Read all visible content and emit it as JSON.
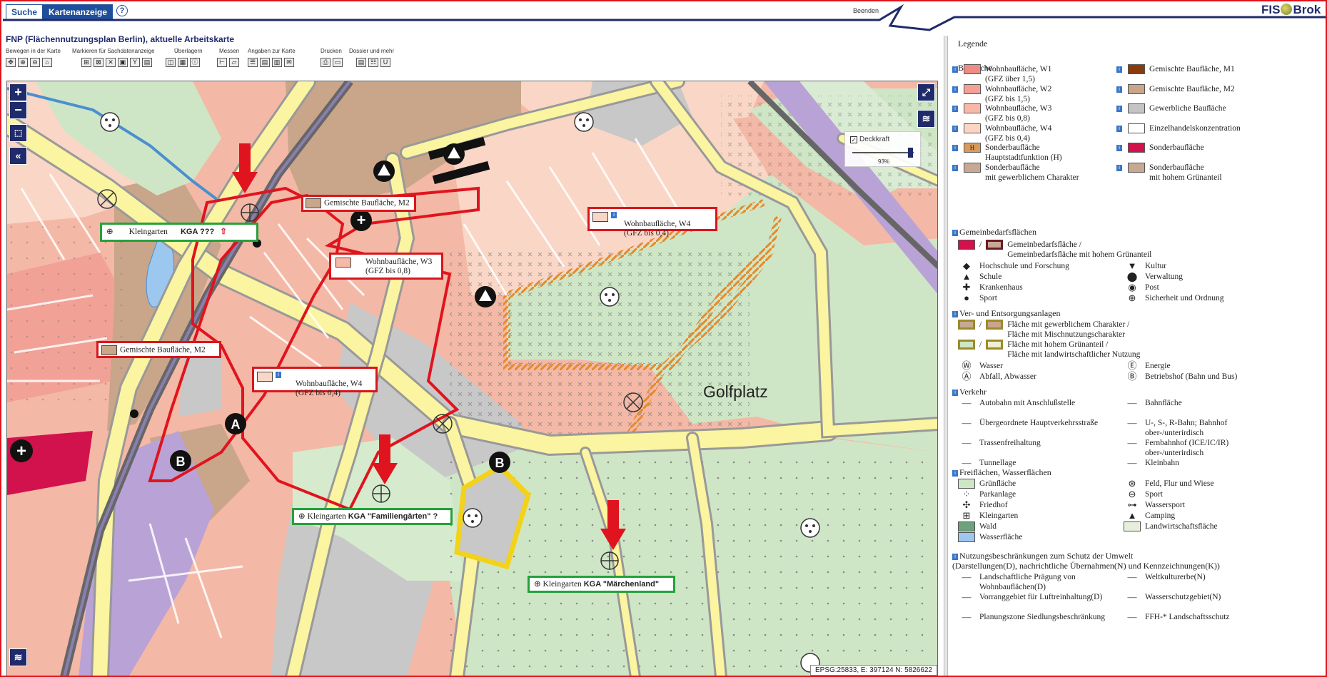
{
  "tabs": [
    {
      "label": "Suche"
    },
    {
      "label": "Kartenanzeige"
    }
  ],
  "help_label": "?",
  "beenden": "Beenden",
  "logo": {
    "text_left": "FIS",
    "text_right": "Brok"
  },
  "page_title": "FNP (Flächennutzungsplan Berlin), aktuelle Arbeitskarte",
  "toolbar": {
    "groups": [
      {
        "label": "Bewegen in der Karte"
      },
      {
        "label": "Markieren für Sachdatenanzeige"
      },
      {
        "label": "Überlagern"
      },
      {
        "label": "Messen"
      },
      {
        "label": "Angaben zur Karte"
      },
      {
        "label": "Drucken"
      },
      {
        "label": "Dossier und mehr"
      }
    ]
  },
  "map": {
    "zoom_in": "+",
    "zoom_out": "−",
    "collapse": "«",
    "opacity": {
      "label": "Deckkraft",
      "value": "93%"
    },
    "epsg": "EPSG:25833, E: 397124 N: 5826622",
    "golf_label": "Golfplatz",
    "callouts": {
      "m2_top": "Gemischte Bauﬂäche, M2",
      "kga1_prefix": "Kleingarten",
      "kga1_name": "KGA ???",
      "w4_top": "Wohnbauﬂäche, W4",
      "w4_top_sub": "(GFZ bis 0,4)",
      "w3": "Wohnbauﬂäche, W3",
      "w3_sub": "(GFZ bis 0,8)",
      "m2_left": "Gemischte Bauﬂäche, M2",
      "w4_mid": "Wohnbauﬂäche, W4",
      "w4_mid_sub": "(GFZ bis 0,4)",
      "kga2_prefix": "Kleingarten",
      "kga2_name": "KGA \"Familiengärten\" ?",
      "kga3_prefix": "Kleingarten",
      "kga3_name": "KGA \"Märchenland\""
    },
    "colors": {
      "w4": "#f9d6c6",
      "w3": "#f6b9a8",
      "m2": "#c9a58a",
      "green": "#cfe6c6",
      "gray": "#c8c8c8",
      "road": "#fbf4a0",
      "bahn": "#b9a3d6",
      "callout_red": "#d8161d",
      "callout_green": "#24a13a"
    }
  },
  "legend": {
    "title": "Legende",
    "bauflaeche": {
      "heading": "Bauﬂäche",
      "left": [
        {
          "l1": "Wohnbauﬂäche, W1",
          "l2": "(GFZ über 1,5)",
          "color": "#f08a82"
        },
        {
          "l1": "Wohnbauﬂäche, W2",
          "l2": "(GFZ bis 1,5)",
          "color": "#f4a097"
        },
        {
          "l1": "Wohnbauﬂäche, W3",
          "l2": "(GFZ bis 0,8)",
          "color": "#f7b8a8"
        },
        {
          "l1": "Wohnbauﬂäche, W4",
          "l2": "(GFZ bis 0,4)",
          "color": "#fad5c4"
        },
        {
          "l1": "Sonderbauﬂäche",
          "l2": "Hauptstadtfunktion (H)",
          "color": "#d79a5c",
          "sym": "H"
        },
        {
          "l1": "Sonderbauﬂäche",
          "l2": "mit gewerblichem Charakter",
          "color": "#c7a993"
        }
      ],
      "right": [
        {
          "l1": "Gemischte Bauﬂäche, M1",
          "color": "#8a3b0d"
        },
        {
          "l1": "Gemischte Bauﬂäche, M2",
          "color": "#caa58a"
        },
        {
          "l1": "Gewerbliche Bauﬂäche",
          "color": "#c4c4c4"
        },
        {
          "l1": "Einzelhandelskonzentration",
          "color": "#ffffff"
        },
        {
          "l1": "Sonderbauﬂäche",
          "color": "#d1124c"
        },
        {
          "l1": "Sonderbauﬂäche",
          "l2": "mit hohem Grünanteil",
          "color": "#c7a993"
        }
      ]
    },
    "gemeinbedarf": {
      "heading": "Gemeinbedarfsﬂächen",
      "main1": "Gemeinbedarfsﬂäche /",
      "main2": "Gemeinbedarfsﬂäche mit hohem Grünanteil",
      "left": [
        {
          "label": "Hochschule und Forschung",
          "sym": "◆"
        },
        {
          "label": "Schule",
          "sym": "▲"
        },
        {
          "label": "Krankenhaus",
          "sym": "✚"
        },
        {
          "label": "Sport",
          "sym": "●"
        }
      ],
      "right": [
        {
          "label": "Kultur",
          "sym": "▼"
        },
        {
          "label": "Verwaltung",
          "sym": "⬤"
        },
        {
          "label": "Post",
          "sym": "◉"
        },
        {
          "label": "Sicherheit und Ordnung",
          "sym": "⊕"
        }
      ]
    },
    "versorgung": {
      "heading": "Ver- und Entsorgungsanlagen",
      "row1a": "Fläche mit gewerblichem Charakter /",
      "row1b": "Fläche mit Mischnutzungscharakter",
      "row2a": "Fläche mit hohem Grünanteil /",
      "row2b": "Fläche mit landwirtschaftlicher Nutzung",
      "left": [
        {
          "label": "Wasser",
          "sym": "Ⓦ"
        },
        {
          "label": "Abfall, Abwasser",
          "sym": "Ⓐ"
        }
      ],
      "right": [
        {
          "label": "Energie",
          "sym": "Ⓔ"
        },
        {
          "label": "Betriebshof (Bahn und Bus)",
          "sym": "Ⓑ"
        }
      ]
    },
    "verkehr": {
      "heading": "Verkehr",
      "left": [
        {
          "l1": "Autobahn mit Anschlußstelle"
        },
        {
          "l1": "Übergeordnete Hauptverkehrsstraße"
        },
        {
          "l1": "Trassenfreihaltung"
        },
        {
          "l1": "Tunnellage"
        }
      ],
      "right": [
        {
          "l1": "Bahnﬂäche"
        },
        {
          "l1": "U-, S-, R-Bahn; Bahnhof",
          "l2": "ober-/unterirdisch"
        },
        {
          "l1": "Fernbahnhof (ICE/IC/IR)",
          "l2": "ober-/unterirdisch"
        },
        {
          "l1": "Kleinbahn"
        }
      ]
    },
    "frei": {
      "heading": "Freiﬂächen, Wasserﬂächen",
      "left": [
        {
          "label": "Grünﬂäche",
          "color": "#cfe6c6"
        },
        {
          "label": "Parkanlage",
          "sym": "⁘"
        },
        {
          "label": "Friedhof",
          "sym": "✣"
        },
        {
          "label": "Kleingarten",
          "sym": "⊞"
        },
        {
          "label": "Wald",
          "color": "#6fa27c"
        },
        {
          "label": "Wasserﬂäche",
          "color": "#9cc8f0"
        }
      ],
      "right": [
        {
          "label": "Feld, Flur und Wiese",
          "sym": "⊛"
        },
        {
          "label": "Sport",
          "sym": "⊖"
        },
        {
          "label": "Wassersport",
          "sym": "⊶"
        },
        {
          "label": "Camping",
          "sym": "▲"
        },
        {
          "label": "Landwirtschaftsﬂäche",
          "color": "#e6efdc"
        }
      ]
    },
    "nutzung": {
      "heading1": "Nutzungsbeschränkungen zum Schutz der Umwelt",
      "heading2": "(Darstellungen(D), nachrichtliche Übernahmen(N) und Kennzeichnungen(K))",
      "left": [
        {
          "l1": "Landschaftliche Prägung von",
          "l2": "Wohnbauﬂächen(D)"
        },
        {
          "l1": "Vorranggebiet für Luftreinhaltung(D)"
        },
        {
          "l1": "Planungszone Siedlungsbeschränkung"
        }
      ],
      "right": [
        {
          "l1": "Weltkulturerbe(N)"
        },
        {
          "l1": "Wasserschutzgebiet(N)"
        },
        {
          "l1": "FFH-* Landschaftsschutz"
        }
      ]
    }
  }
}
